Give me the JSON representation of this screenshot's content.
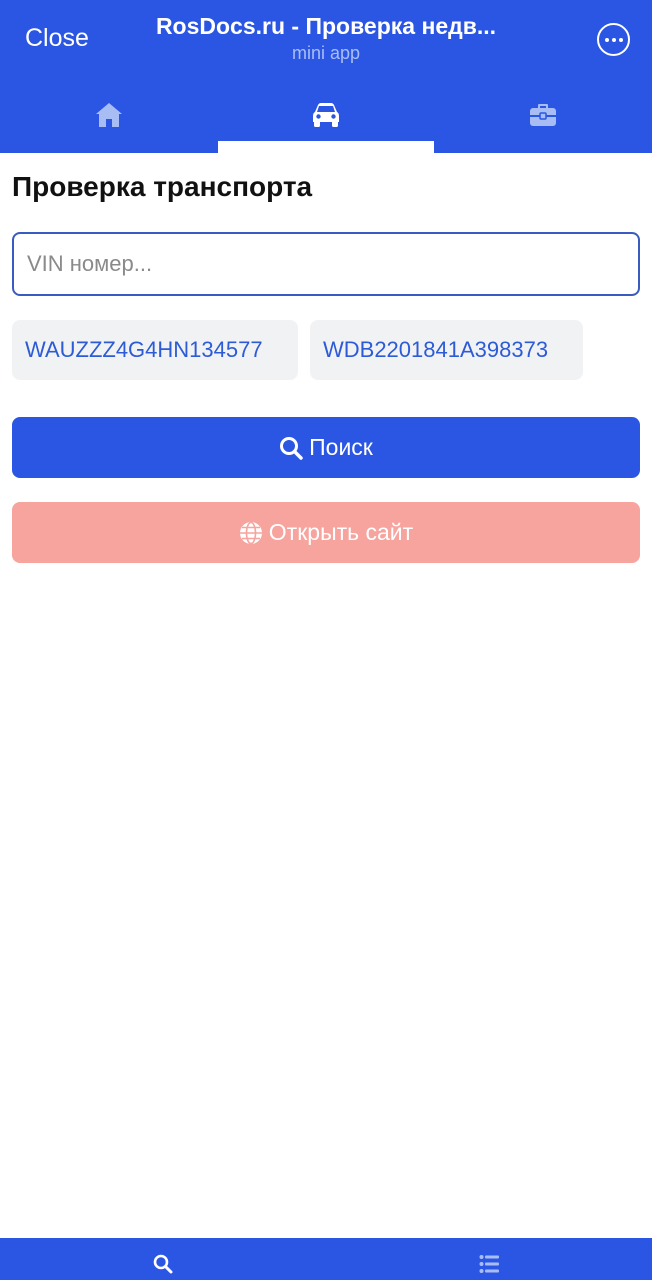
{
  "header": {
    "close_label": "Close",
    "title": "RosDocs.ru - Проверка недв...",
    "subtitle": "mini app"
  },
  "tabs": [
    {
      "icon": "home-icon",
      "active": false
    },
    {
      "icon": "car-icon",
      "active": true
    },
    {
      "icon": "briefcase-icon",
      "active": false
    }
  ],
  "main": {
    "title": "Проверка транспорта",
    "vin_input": {
      "placeholder": "VIN номер...",
      "value": ""
    },
    "examples": [
      "WAUZZZ4G4HN134577",
      "WDB2201841A398373"
    ],
    "search_label": "Поиск",
    "open_site_label": "Открыть сайт"
  },
  "bottom_bar": [
    {
      "icon": "search-icon",
      "active": true
    },
    {
      "icon": "list-icon",
      "active": false
    }
  ],
  "colors": {
    "brand": "#2B56E3",
    "tab_inactive": "#A9BDF5",
    "chip_text": "#2D5BD6",
    "chip_bg": "#F1F2F4",
    "open_site_bg": "#F7A39E"
  }
}
